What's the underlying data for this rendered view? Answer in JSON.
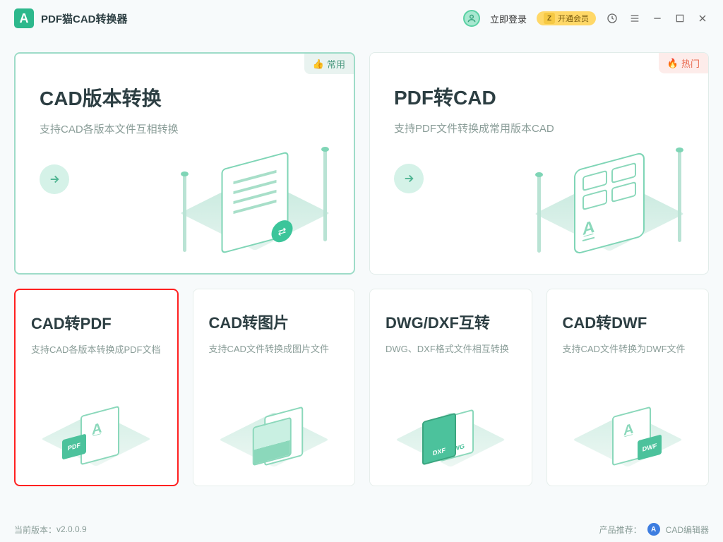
{
  "titlebar": {
    "app_title": "PDF猫CAD转换器",
    "login_label": "立即登录",
    "vip_label": "开通会员"
  },
  "cards": {
    "large": [
      {
        "title": "CAD版本转换",
        "subtitle": "支持CAD各版本文件互相转换",
        "badge": "常用",
        "badge_icon": "👍",
        "badge_type": "common"
      },
      {
        "title": "PDF转CAD",
        "subtitle": "支持PDF文件转换成常用版本CAD",
        "badge": "热门",
        "badge_icon": "🔥",
        "badge_type": "hot"
      }
    ],
    "small": [
      {
        "title": "CAD转PDF",
        "subtitle": "支持CAD各版本转换成PDF文档",
        "label": "PDF"
      },
      {
        "title": "CAD转图片",
        "subtitle": "支持CAD文件转换成图片文件"
      },
      {
        "title": "DWG/DXF互转",
        "subtitle": "DWG、DXF格式文件相互转换",
        "label1": "DXF",
        "label2": "DWG"
      },
      {
        "title": "CAD转DWF",
        "subtitle": "支持CAD文件转换为DWF文件",
        "label": "DWF"
      }
    ]
  },
  "footer": {
    "version_label": "当前版本：",
    "version": "v2.0.0.9",
    "recommend_label": "产品推荐：",
    "recommend_product": "CAD编辑器"
  },
  "colors": {
    "accent": "#2db88c",
    "highlight_border": "#ff2020"
  }
}
